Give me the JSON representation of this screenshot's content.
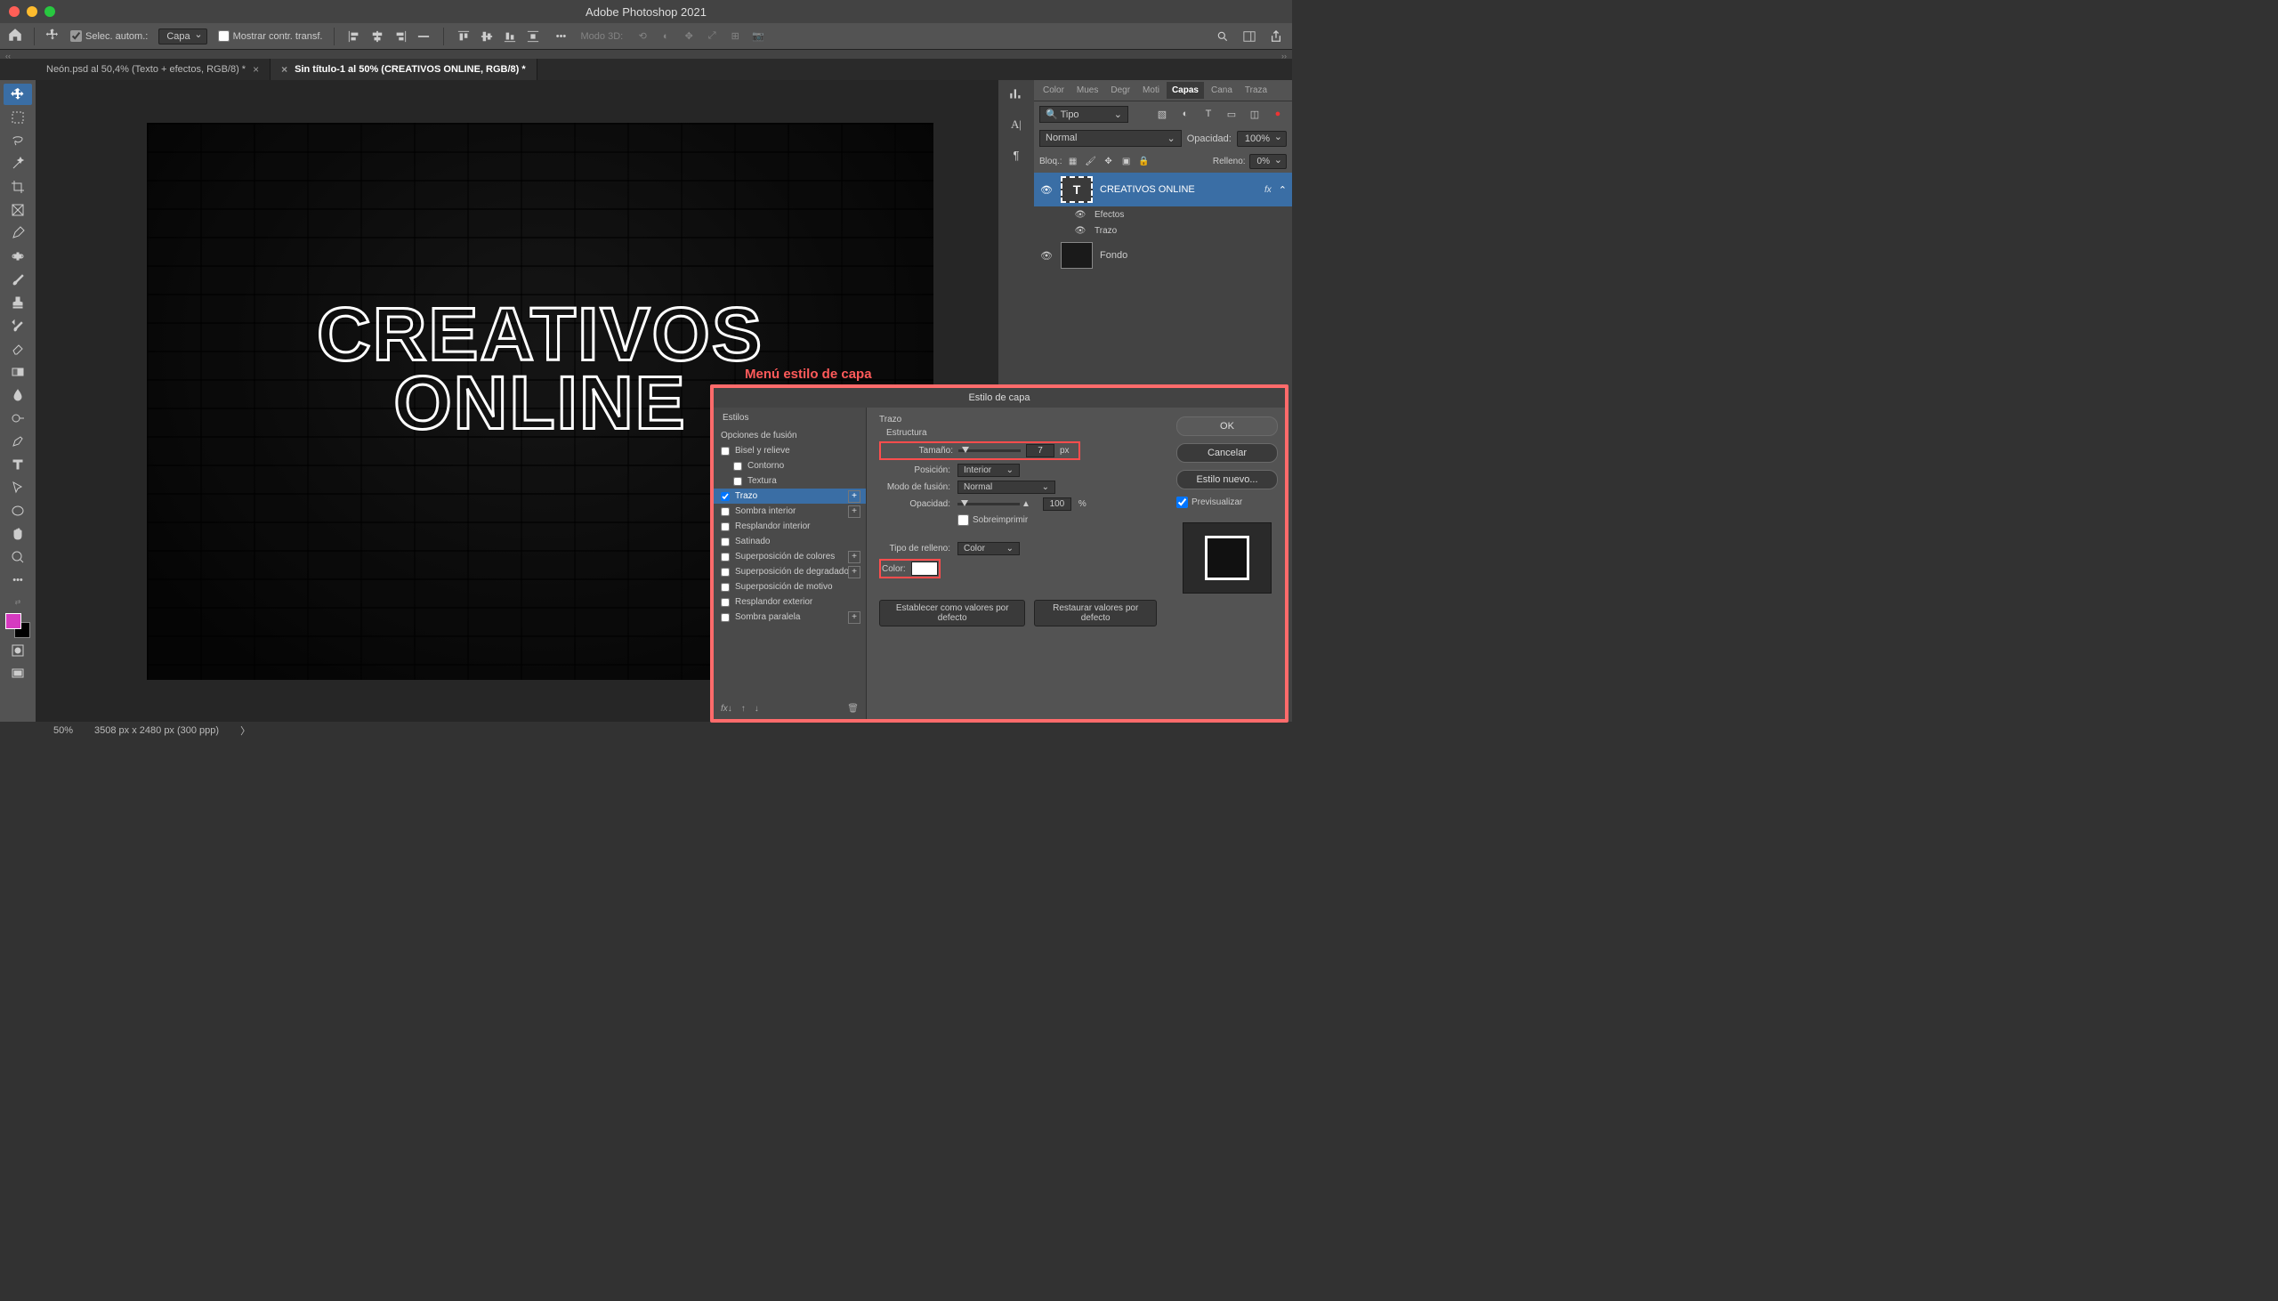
{
  "title": "Adobe Photoshop 2021",
  "optionsBar": {
    "autoSelect": "Selec. autom.:",
    "dropdown": "Capa",
    "showTransform": "Mostrar contr. transf.",
    "mode3d": "Modo 3D:"
  },
  "docTabs": [
    {
      "label": "Neón.psd al 50,4% (Texto + efectos, RGB/8) *"
    },
    {
      "label": "Sin título-1 al 50% (CREATIVOS  ONLINE, RGB/8) *"
    }
  ],
  "canvasText": {
    "line1": "CREATIVOS",
    "line2": "ONLINE"
  },
  "annotation": "Menú estilo de capa",
  "panelTabs": [
    "Color",
    "Mues",
    "Degr",
    "Moti",
    "Capas",
    "Cana",
    "Traza"
  ],
  "layersPanel": {
    "kind": "Tipo",
    "blend": "Normal",
    "opacityLabel": "Opacidad:",
    "opacityValue": "100%",
    "lockLabel": "Bloq.:",
    "fillLabel": "Relleno:",
    "fillValue": "0%",
    "layers": [
      {
        "name": "CREATIVOS  ONLINE",
        "fx": "fx"
      },
      {
        "sub": "Efectos"
      },
      {
        "sub": "Trazo"
      },
      {
        "name": "Fondo"
      }
    ]
  },
  "status": {
    "zoom": "50%",
    "dims": "3508 px x 2480 px (300 ppp)"
  },
  "dialog": {
    "title": "Estilo de capa",
    "leftHeader": "Estilos",
    "leftBlend": "Opciones de fusión",
    "styles": [
      "Bisel y relieve",
      "Contorno",
      "Textura",
      "Trazo",
      "Sombra interior",
      "Resplandor interior",
      "Satinado",
      "Superposición de colores",
      "Superposición de degradado",
      "Superposición de motivo",
      "Resplandor exterior",
      "Sombra paralela"
    ],
    "midHeader": "Trazo",
    "structure": "Estructura",
    "size": {
      "label": "Tamaño:",
      "value": "7",
      "unit": "px"
    },
    "position": {
      "label": "Posición:",
      "value": "Interior"
    },
    "blendMode": {
      "label": "Modo de fusión:",
      "value": "Normal"
    },
    "opacity": {
      "label": "Opacidad:",
      "value": "100",
      "unit": "%"
    },
    "overprint": "Sobreimprimir",
    "fillType": {
      "label": "Tipo de relleno:",
      "value": "Color"
    },
    "colorLabel": "Color:",
    "resetDefault": "Establecer como valores por defecto",
    "restoreDefault": "Restaurar valores por defecto",
    "ok": "OK",
    "cancel": "Cancelar",
    "newStyle": "Estilo nuevo...",
    "preview": "Previsualizar"
  }
}
